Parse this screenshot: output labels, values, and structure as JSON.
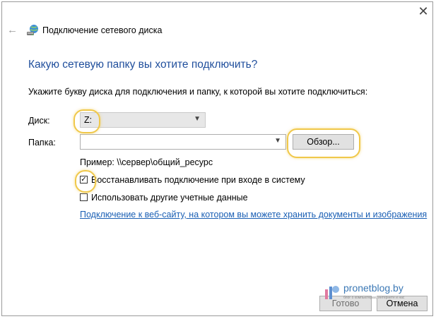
{
  "window": {
    "title": "Подключение сетевого диска",
    "close_label": "✕",
    "back_label": "←"
  },
  "main": {
    "heading": "Какую сетевую папку вы хотите подключить?",
    "instruction": "Укажите букву диска для подключения и папку, к которой вы хотите подключиться:",
    "drive_label": "Диск:",
    "drive_value": "Z:",
    "folder_label": "Папка:",
    "folder_value": "",
    "browse_label": "Обзор...",
    "example_text": "Пример: \\\\сервер\\общий_ресурс",
    "reconnect_label": "Восстанавливать подключение при входе в систему",
    "reconnect_checked": true,
    "other_credentials_label": "Использовать другие учетные данные",
    "other_credentials_checked": false,
    "website_link": "Подключение к веб-сайту, на котором вы можете хранить документы и изображения"
  },
  "footer": {
    "finish_label": "Готово",
    "cancel_label": "Отмена"
  },
  "watermark": {
    "text": "pronetblog.by",
    "subtext": "блог о компьютерах, интернете и нас"
  },
  "colors": {
    "heading": "#1f4e9c",
    "link": "#1a5fb4",
    "highlight": "#f0c84a",
    "disabled_text": "#6d6d6d"
  },
  "icons": {
    "back": "arrow-left-icon",
    "wizard": "network-drive-icon",
    "close": "close-icon",
    "dropdown": "chevron-down-icon"
  }
}
